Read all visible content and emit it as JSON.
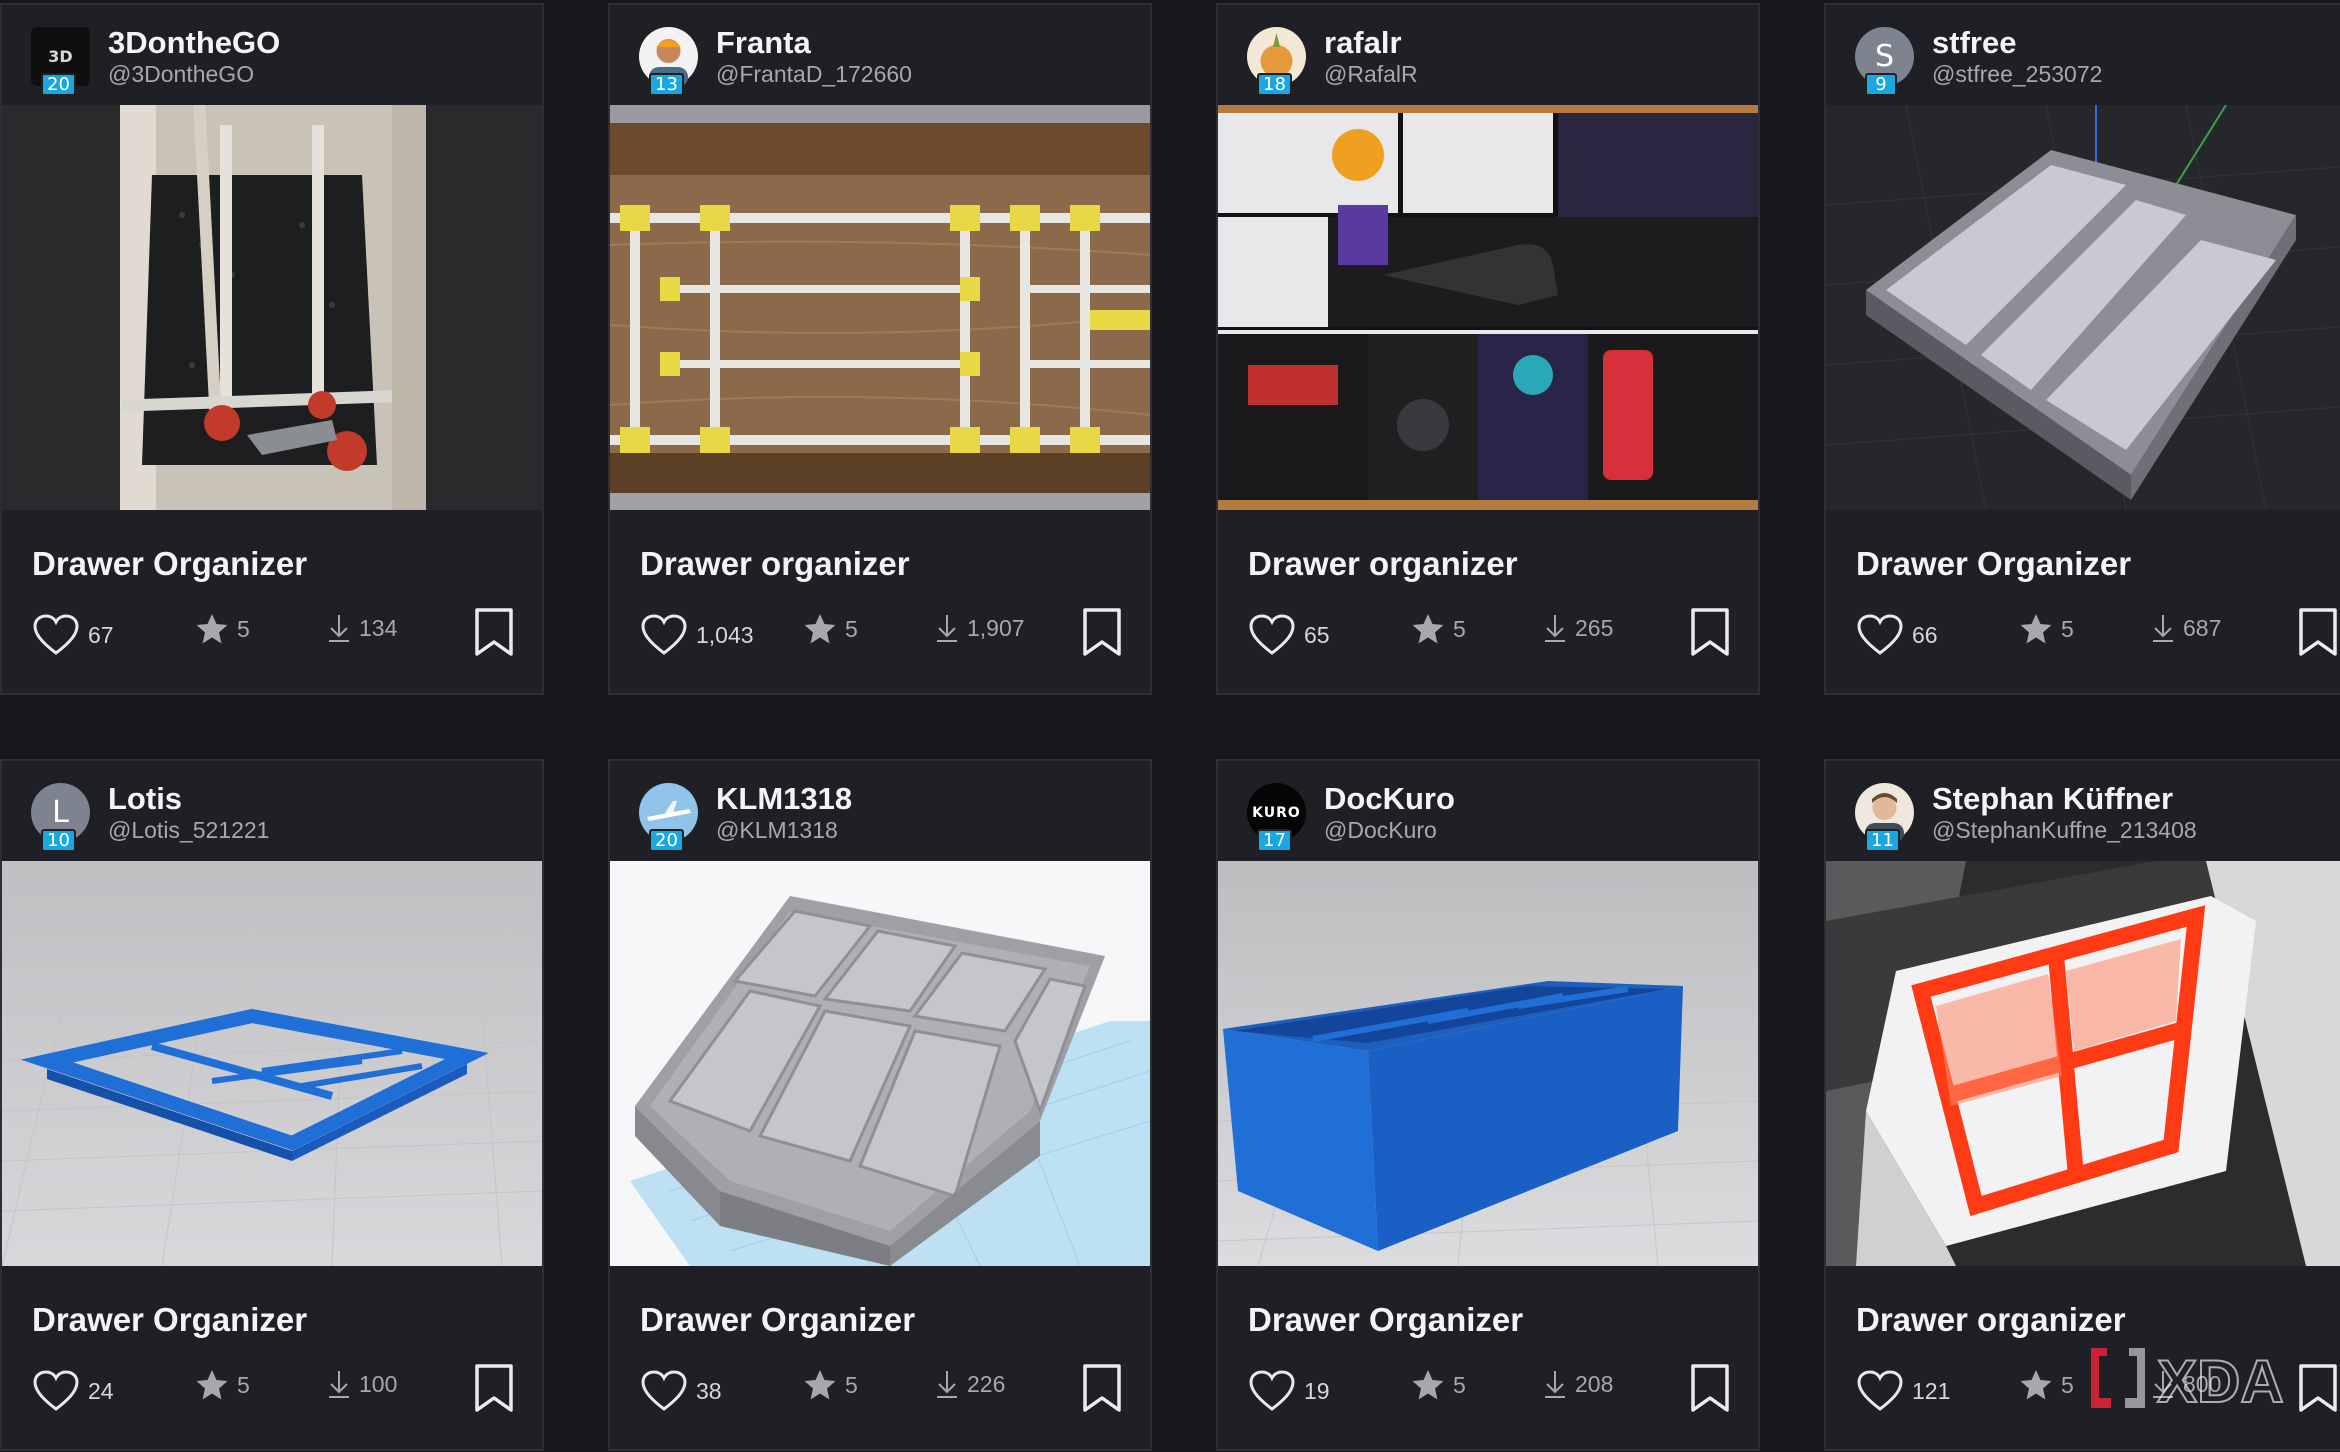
{
  "cards": [
    {
      "username": "3DontheGO",
      "handle": "@3DontheGO",
      "level": "20",
      "avatar_letter": "",
      "title": "Drawer Organizer",
      "likes": "67",
      "rating": "5",
      "downloads": "134"
    },
    {
      "username": "Franta",
      "handle": "@FrantaD_172660",
      "level": "13",
      "avatar_letter": "",
      "title": "Drawer organizer",
      "likes": "1,043",
      "rating": "5",
      "downloads": "1,907"
    },
    {
      "username": "rafalr",
      "handle": "@RafalR",
      "level": "18",
      "avatar_letter": "",
      "title": "Drawer organizer",
      "likes": "65",
      "rating": "5",
      "downloads": "265"
    },
    {
      "username": "stfree",
      "handle": "@stfree_253072",
      "level": "9",
      "avatar_letter": "S",
      "title": "Drawer Organizer",
      "likes": "66",
      "rating": "5",
      "downloads": "687"
    },
    {
      "username": "Lotis",
      "handle": "@Lotis_521221",
      "level": "10",
      "avatar_letter": "L",
      "title": "Drawer Organizer",
      "likes": "24",
      "rating": "5",
      "downloads": "100"
    },
    {
      "username": "KLM1318",
      "handle": "@KLM1318",
      "level": "20",
      "avatar_letter": "",
      "title": "Drawer Organizer",
      "likes": "38",
      "rating": "5",
      "downloads": "226"
    },
    {
      "username": "DocKuro",
      "handle": "@DocKuro",
      "level": "17",
      "avatar_letter": "KURO",
      "title": "Drawer Organizer",
      "likes": "19",
      "rating": "5",
      "downloads": "208"
    },
    {
      "username": "Stephan Küffner",
      "handle": "@StephanKuffne_213408",
      "level": "11",
      "avatar_letter": "",
      "title": "Drawer organizer",
      "likes": "121",
      "rating": "5",
      "downloads": "800"
    }
  ],
  "watermark": "XDA",
  "colors": {
    "background": "#16171b",
    "card": "#1f2025",
    "level_badge": "#1aa7e0",
    "muted_text": "#a6a8ae"
  },
  "icons": {
    "likes": "heart-icon",
    "rating": "star-icon",
    "downloads": "download-icon",
    "save": "bookmark-icon"
  }
}
